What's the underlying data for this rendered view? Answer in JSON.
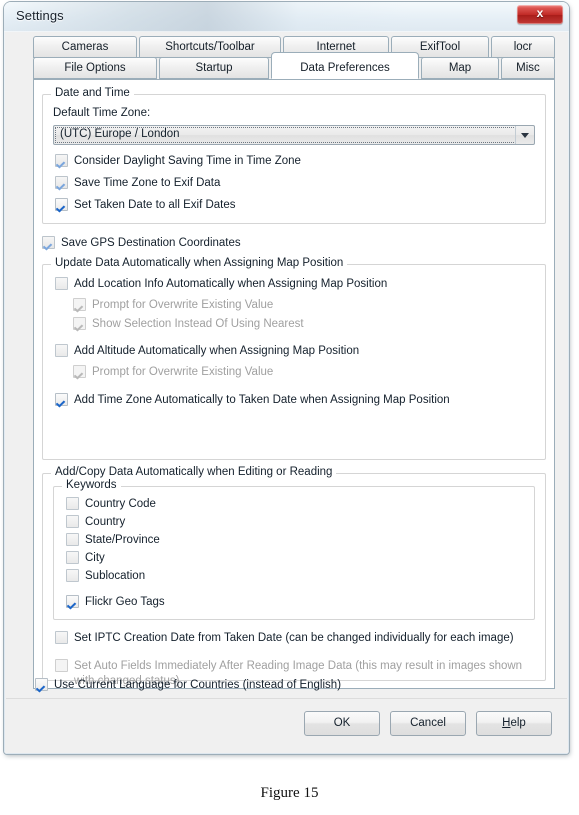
{
  "window": {
    "title": "Settings",
    "close_label": "x",
    "accent_close": "#c02a26"
  },
  "tabs": {
    "row1": [
      {
        "label": "Cameras"
      },
      {
        "label": "Shortcuts/Toolbar"
      },
      {
        "label": "Internet"
      },
      {
        "label": "ExifTool"
      },
      {
        "label": "locr"
      }
    ],
    "row2": [
      {
        "label": "File Options"
      },
      {
        "label": "Startup"
      },
      {
        "label": "Data Preferences"
      },
      {
        "label": "Map"
      },
      {
        "label": "Misc"
      }
    ],
    "selected": "Data Preferences"
  },
  "date_time_group": {
    "legend": "Date and Time",
    "tz_label": "Default Time Zone:",
    "tz_value": "(UTC) Europe / London",
    "options": [
      "Consider Daylight Saving Time in Time Zone",
      "Save Time Zone to Exif Data",
      "Set Taken Date to all Exif Dates"
    ]
  },
  "save_gps": {
    "label": "Save GPS Destination Coordinates"
  },
  "update_group": {
    "legend": "Update Data Automatically when Assigning Map Position",
    "add_location": "Add Location Info Automatically when Assigning Map Position",
    "location_children": [
      "Prompt for Overwrite Existing Value",
      "Show Selection Instead Of Using Nearest"
    ],
    "add_altitude": "Add Altitude Automatically when Assigning Map Position",
    "altitude_children": [
      "Prompt for Overwrite Existing Value"
    ],
    "add_timezone": "Add Time Zone Automatically to Taken Date when Assigning Map Position"
  },
  "addcopy_group": {
    "legend": "Add/Copy Data Automatically when Editing or Reading",
    "keywords_legend": "Keywords",
    "keywords": [
      "Country Code",
      "Country",
      "State/Province",
      "City",
      "Sublocation"
    ],
    "flickr": "Flickr Geo Tags",
    "iptc": "Set IPTC Creation Date from Taken Date (can be changed individually for each image)",
    "auto_fields": "Set Auto Fields Immediately After Reading Image Data (this may result in images shown with changed status)"
  },
  "language": {
    "label": "Use Current Language for Countries (instead of English)"
  },
  "footer": {
    "ok": "OK",
    "cancel": "Cancel",
    "help_prefix": "H",
    "help_suffix": "elp"
  },
  "caption": {
    "text": "Figure 15"
  }
}
